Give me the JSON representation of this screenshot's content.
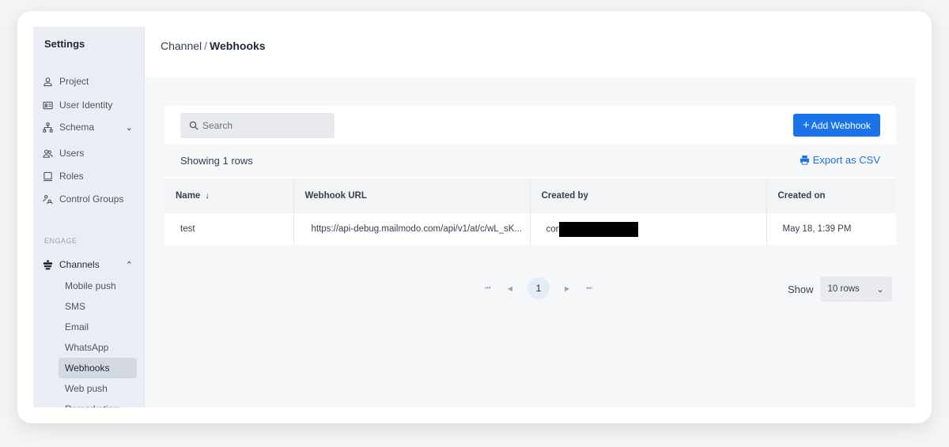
{
  "sidebar": {
    "title": "Settings",
    "items": [
      {
        "label": "Project",
        "icon": "user-icon"
      },
      {
        "label": "User Identity",
        "icon": "id-card-icon"
      },
      {
        "label": "Schema",
        "icon": "hierarchy-icon",
        "expandable": true
      },
      {
        "label": "Users",
        "icon": "users-icon"
      },
      {
        "label": "Roles",
        "icon": "roles-icon"
      },
      {
        "label": "Control Groups",
        "icon": "control-groups-icon"
      }
    ],
    "section_label": "ENGAGE",
    "channels": {
      "label": "Channels",
      "icon": "channels-icon",
      "sub_items": [
        "Mobile push",
        "SMS",
        "Email",
        "WhatsApp",
        "Webhooks",
        "Web push",
        "Remarketing"
      ],
      "active": "Webhooks"
    }
  },
  "breadcrumb": {
    "parent": "Channel",
    "separator": "/",
    "current": "Webhooks"
  },
  "toolbar": {
    "search_placeholder": "Search",
    "add_button": "Add Webhook",
    "add_button_prefix": "+",
    "showing_text": "Showing 1 rows",
    "export_label": "Export as CSV"
  },
  "table": {
    "columns": [
      "Name",
      "Webhook URL",
      "Created by",
      "Created on"
    ],
    "rows": [
      {
        "name": "test",
        "url": "https://api-debug.mailmodo.com/api/v1/at/c/wL_sK...",
        "created_by": "cor",
        "created_on": "May 18, 1:39 PM"
      }
    ]
  },
  "pagination": {
    "current_page": "1",
    "show_label": "Show",
    "rows_option": "10 rows"
  },
  "colors": {
    "accent": "#1a73e8",
    "sidebar_bg": "#eaeef4",
    "active_item": "#d3d9e3"
  }
}
